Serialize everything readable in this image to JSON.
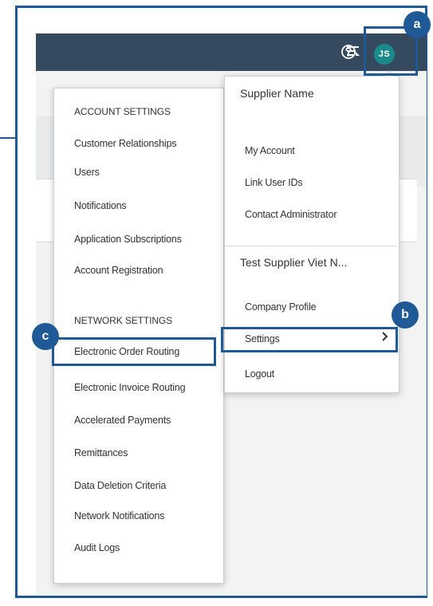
{
  "header": {
    "avatar_initials": "JS"
  },
  "settings_menu": {
    "account_heading": "ACCOUNT SETTINGS",
    "account_items": [
      "Customer Relationships",
      "Users",
      "Notifications",
      "Application Subscriptions",
      "Account Registration"
    ],
    "network_heading": "NETWORK SETTINGS",
    "network_items": [
      "Electronic Order Routing",
      "Electronic Invoice Routing",
      "Accelerated Payments",
      "Remittances",
      "Data Deletion Criteria",
      "Network Notifications",
      "Audit Logs"
    ]
  },
  "account_menu": {
    "user_name": "Supplier Name",
    "items": [
      "My Account",
      "Link User IDs",
      "Contact Administrator"
    ],
    "company_name": "Test Supplier Viet N...",
    "company_items": [
      "Company Profile",
      "Settings",
      "Logout"
    ]
  },
  "callouts": {
    "a": "a",
    "b": "b",
    "c": "c"
  },
  "colors": {
    "topbar": "#354a5f",
    "avatar": "#1a8a8a",
    "callout": "#1f5a96"
  },
  "icons": {
    "notifications": "notification-flag-icon",
    "help": "help-circle-icon",
    "submenu": "chevron-right-icon"
  }
}
